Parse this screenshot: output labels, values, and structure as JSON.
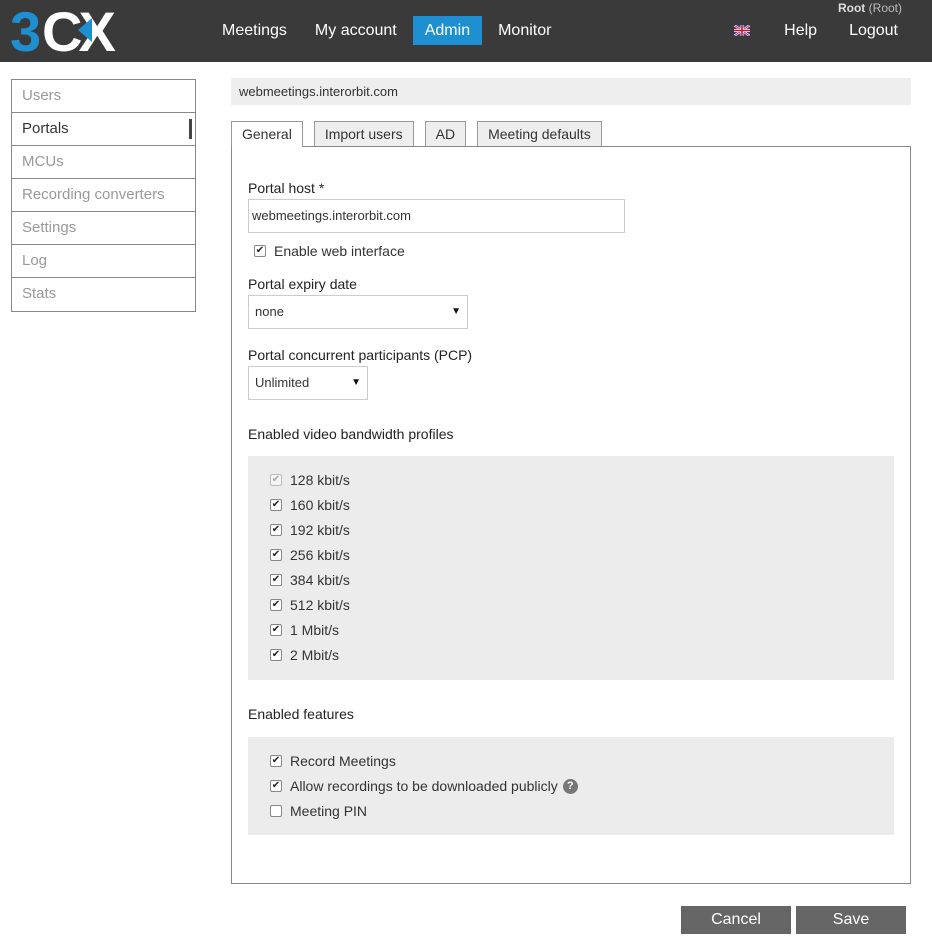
{
  "header": {
    "logo_text": "3CX",
    "nav": [
      "Meetings",
      "My account",
      "Admin",
      "Monitor"
    ],
    "active_nav": "Admin",
    "user_name": "Root",
    "user_role": "(Root)",
    "help": "Help",
    "logout": "Logout",
    "brand_color": "#1e8fd0"
  },
  "sidebar": {
    "items": [
      {
        "label": "Users"
      },
      {
        "label": "Portals"
      },
      {
        "label": "MCUs"
      },
      {
        "label": "Recording converters"
      },
      {
        "label": "Settings"
      },
      {
        "label": "Log"
      },
      {
        "label": "Stats"
      }
    ],
    "active": "Portals"
  },
  "main": {
    "host_title": "webmeetings.interorbit.com",
    "tabs": [
      {
        "label": "General"
      },
      {
        "label": "Import users"
      },
      {
        "label": "AD"
      },
      {
        "label": "Meeting defaults"
      }
    ],
    "portal_host_label": "Portal host *",
    "portal_host_value": "webmeetings.interorbit.com",
    "enable_web_label": "Enable web interface",
    "expiry_label": "Portal expiry date",
    "expiry_value": "none",
    "pcp_label": "Portal concurrent participants (PCP)",
    "pcp_value": "Unlimited",
    "bandwidth_label": "Enabled video bandwidth profiles",
    "bandwidth": [
      {
        "label": "128 kbit/s",
        "checked": true,
        "disabled": true
      },
      {
        "label": "160 kbit/s",
        "checked": true
      },
      {
        "label": "192 kbit/s",
        "checked": true
      },
      {
        "label": "256 kbit/s",
        "checked": true
      },
      {
        "label": "384 kbit/s",
        "checked": true
      },
      {
        "label": "512 kbit/s",
        "checked": true
      },
      {
        "label": "1 Mbit/s",
        "checked": true
      },
      {
        "label": "2 Mbit/s",
        "checked": true
      }
    ],
    "features_label": "Enabled features",
    "features": [
      {
        "label": "Record Meetings",
        "checked": true
      },
      {
        "label": "Allow recordings to be downloaded publicly",
        "checked": true
      },
      {
        "label": "Meeting PIN",
        "checked": false
      }
    ]
  },
  "footer": {
    "cancel": "Cancel",
    "save": "Save"
  }
}
